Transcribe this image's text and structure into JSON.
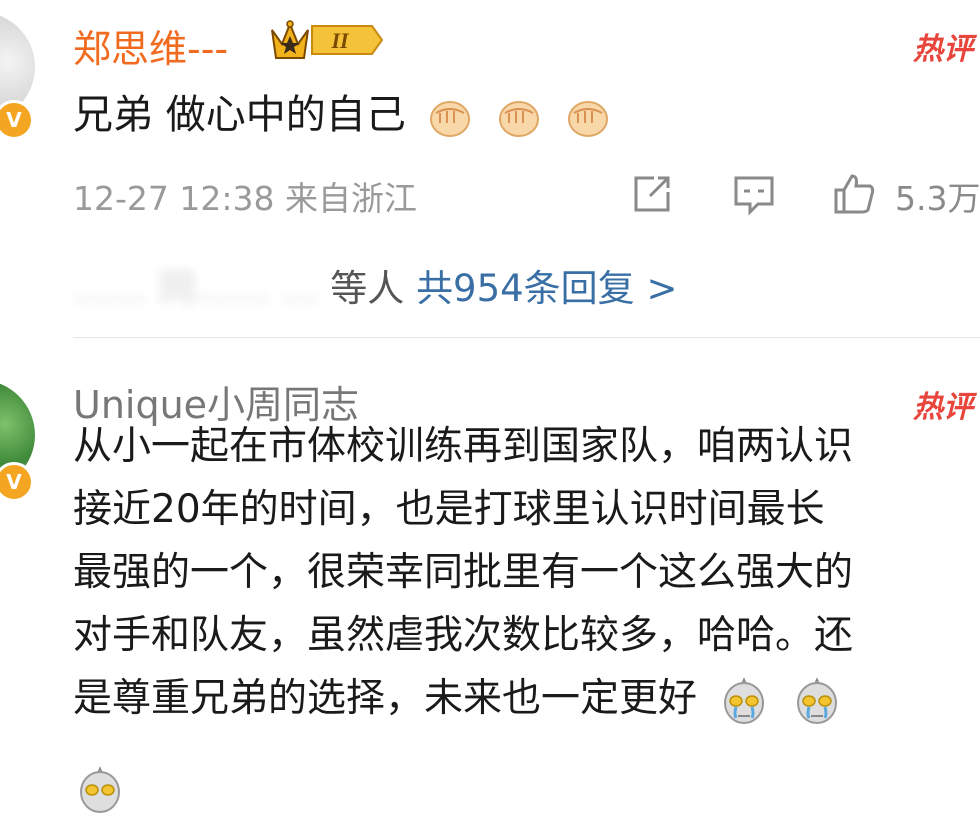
{
  "comment1": {
    "username": "郑思维---",
    "level_badge": "II",
    "hot_label": "热评",
    "content": "兄弟 做心中的自己",
    "emojis": [
      "fist-emoji",
      "fist-emoji",
      "fist-emoji"
    ],
    "timestamp": "12-27 12:38 来自浙江",
    "like_count": "5.3万",
    "replies": {
      "blurred_names": "…… 同……  …",
      "suffix": "等人",
      "count_link": "共954条回复 >"
    }
  },
  "comment2": {
    "username": "Unique小周同志",
    "hot_label": "热评",
    "lines": [
      "从小一起在市体校训练再到国家队，咱两认识",
      "接近20年的时间，也是打球里认识时间最长",
      "最强的一个，很荣幸同批里有一个这么强大的",
      "对手和队友，虽然虐我次数比较多，哈哈。还",
      "是尊重兄弟的选择，未来也一定更好"
    ]
  },
  "colors": {
    "vip_name": "#f06b1f",
    "hot": "#e8453c",
    "link": "#3a6fa5",
    "verified_badge": "#f4a623"
  },
  "badges": {
    "verified": "V"
  }
}
